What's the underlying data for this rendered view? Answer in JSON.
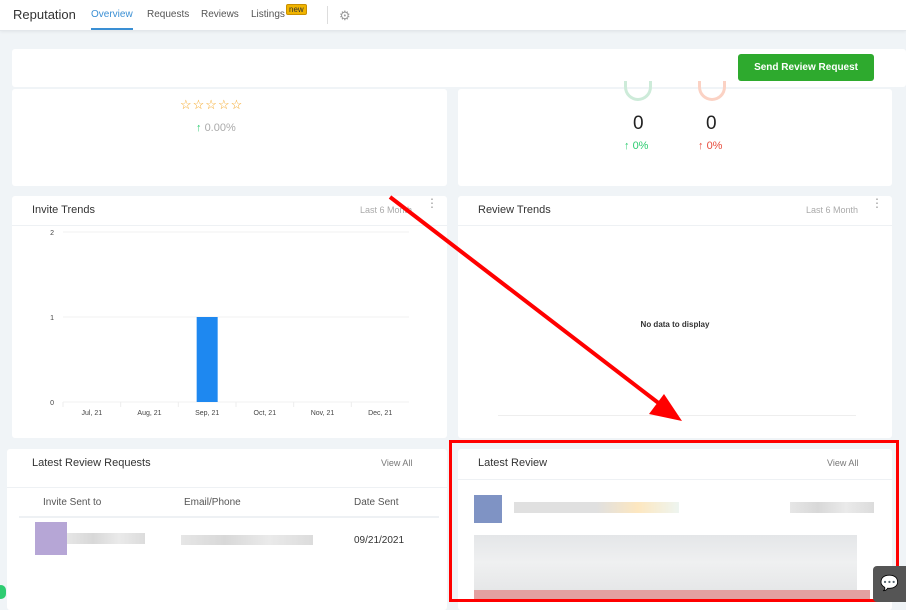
{
  "nav": {
    "title": "Reputation",
    "tabs": [
      {
        "label": "Overview",
        "active": true
      },
      {
        "label": "Requests"
      },
      {
        "label": "Reviews"
      },
      {
        "label": "Listings",
        "badge": "new"
      }
    ],
    "settings_icon": "gear-icon"
  },
  "toolbar": {
    "send_label": "Send Review Request",
    "send_color": "#2eaa2e"
  },
  "rating": {
    "stars": 0,
    "max_stars": 5,
    "change": "0.00%"
  },
  "sentiment": {
    "positive": {
      "count": "0",
      "change": "0%",
      "color": "#2ecc71"
    },
    "negative": {
      "count": "0",
      "change": "0%",
      "color": "#e74c3c"
    }
  },
  "invite_trends": {
    "title": "Invite Trends",
    "range": "Last 6 Month"
  },
  "review_trends": {
    "title": "Review Trends",
    "range": "Last 6 Month",
    "empty": "No data to display"
  },
  "chart_data": {
    "type": "bar",
    "categories": [
      "Jul, 21",
      "Aug, 21",
      "Sep, 21",
      "Oct, 21",
      "Nov, 21",
      "Dec, 21"
    ],
    "values": [
      0,
      0,
      1,
      0,
      0,
      0
    ],
    "yticks": [
      "0",
      "1",
      "2"
    ],
    "ylim": [
      0,
      2
    ],
    "grid": true,
    "color": "#1e88f0"
  },
  "requests": {
    "title": "Latest Review Requests",
    "view_all": "View All",
    "columns": [
      "Invite Sent to",
      "Email/Phone",
      "Date Sent"
    ],
    "rows": [
      {
        "date": "09/21/2021"
      }
    ]
  },
  "latest_review": {
    "title": "Latest Review",
    "view_all": "View All"
  },
  "annotation_color": "#ff0000"
}
